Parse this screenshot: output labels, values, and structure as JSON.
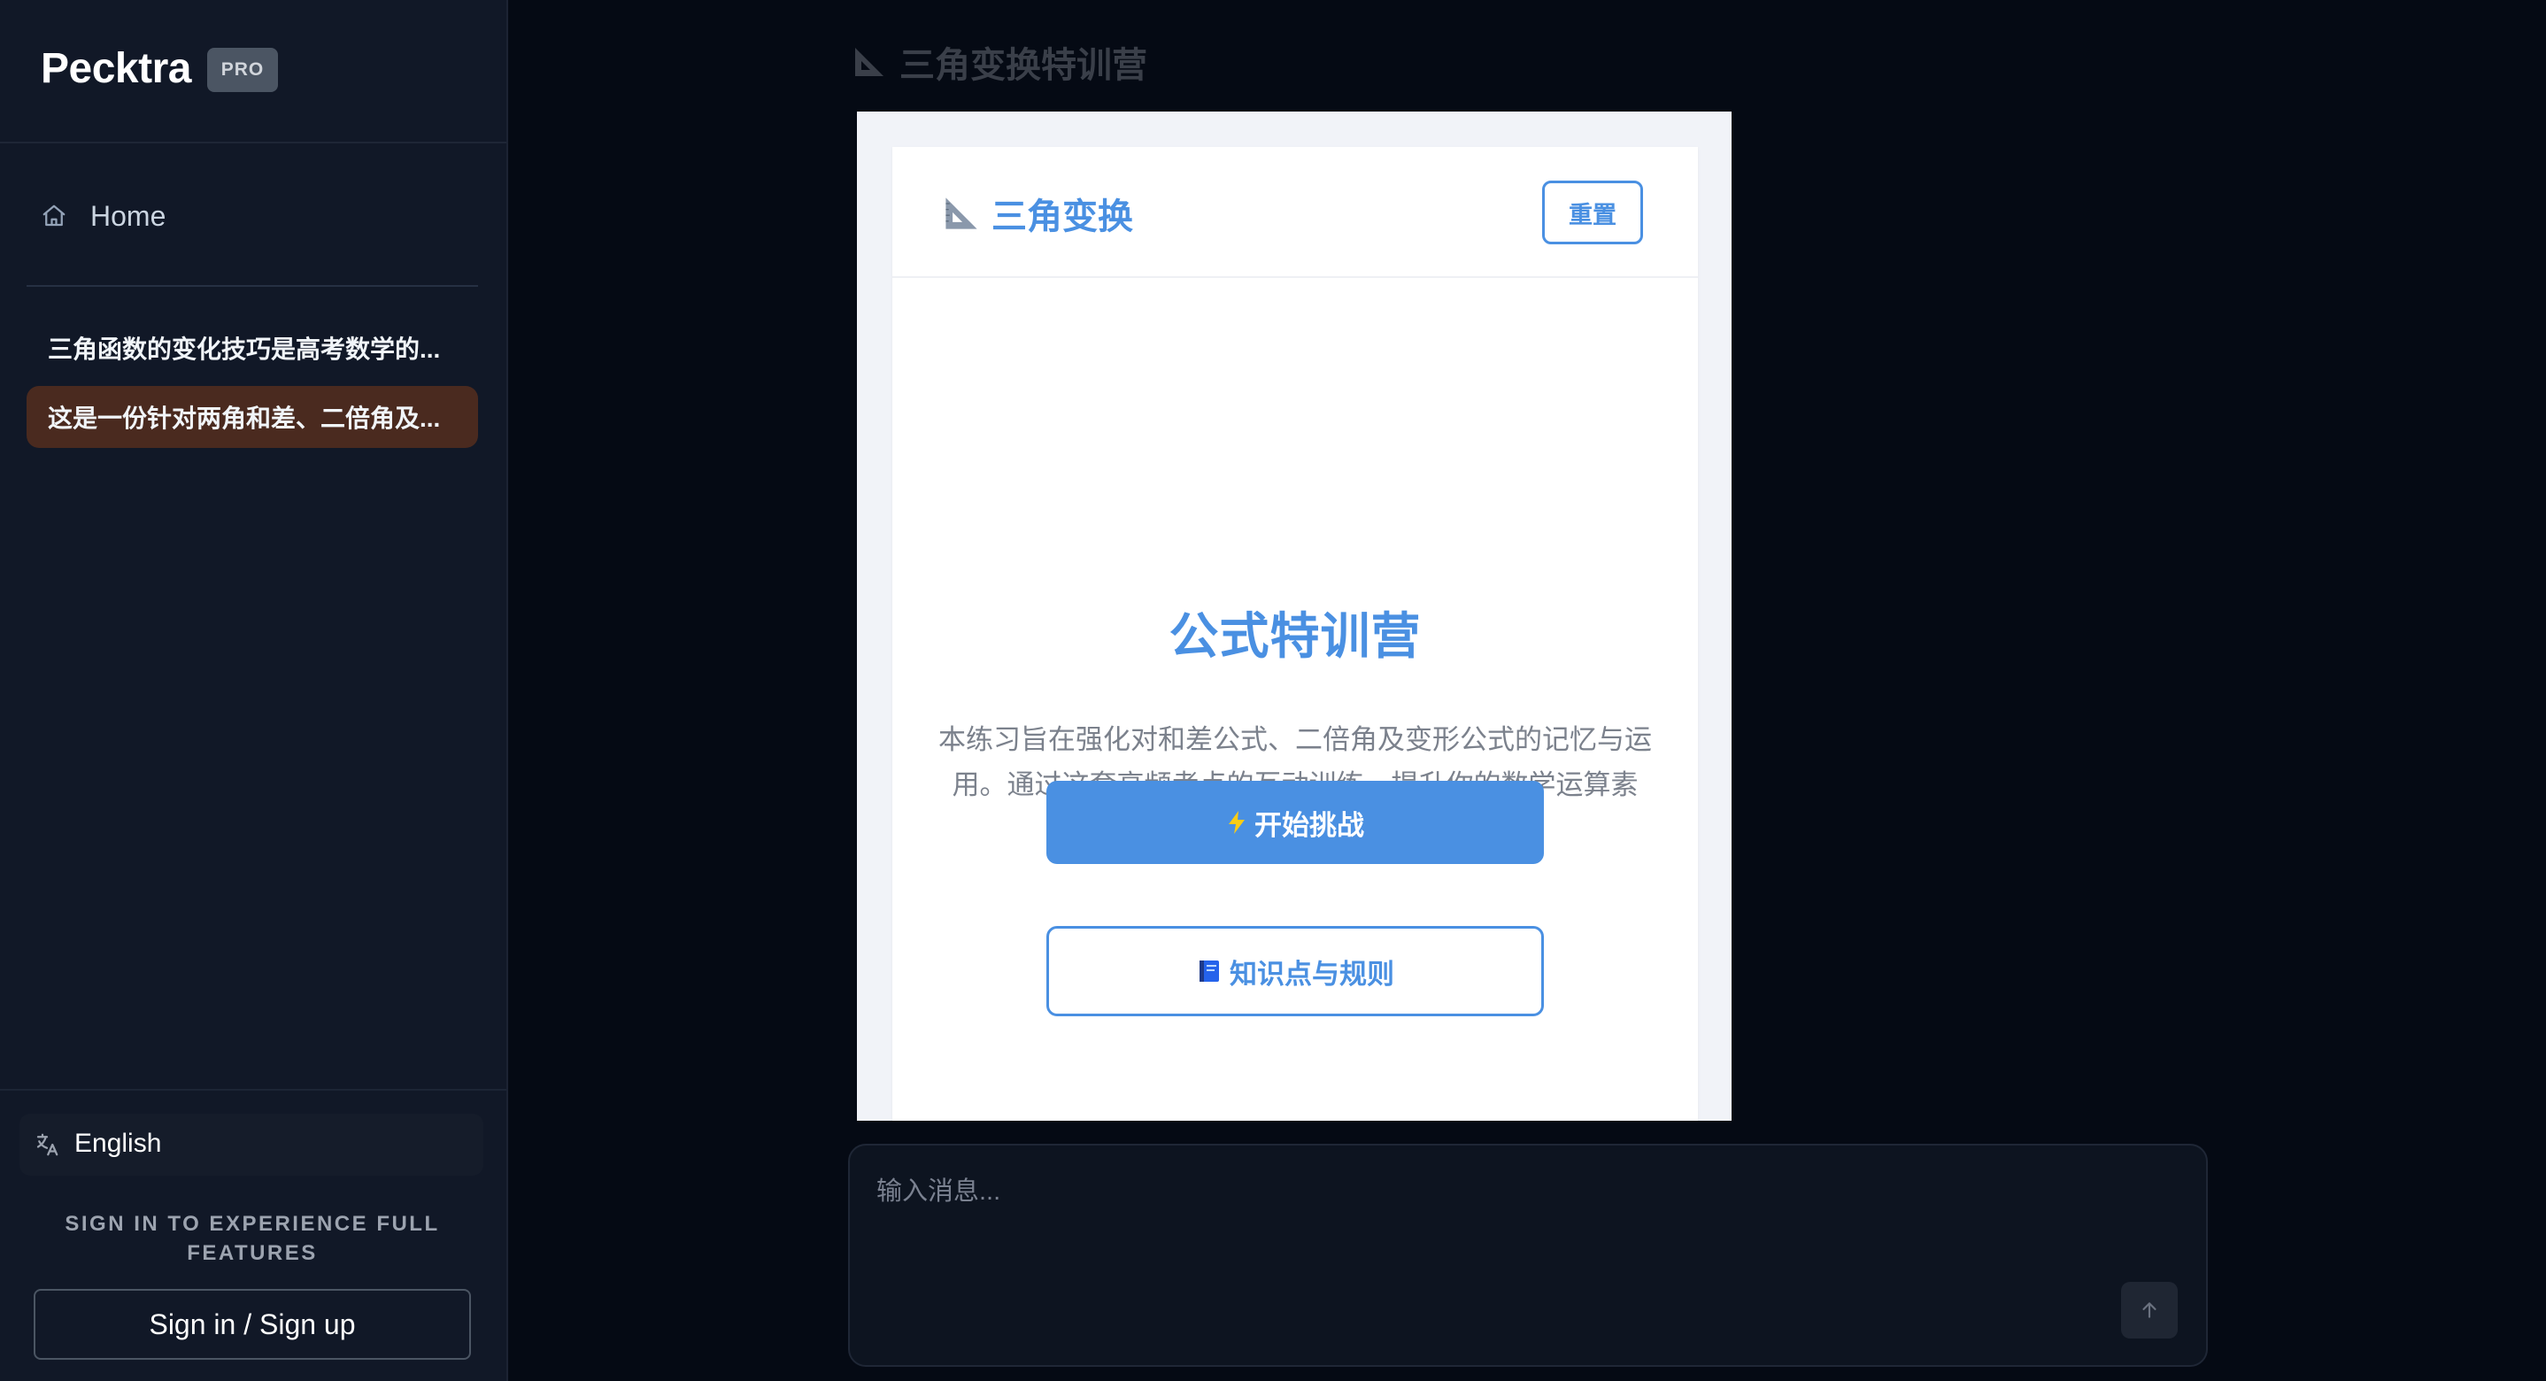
{
  "sidebar": {
    "brand": {
      "name": "Pecktra",
      "badge": "PRO"
    },
    "nav": {
      "home_label": "Home"
    },
    "history": [
      {
        "title": "三角函数的变化技巧是高考数学的..."
      },
      {
        "title": "这是一份针对两角和差、二倍角及...",
        "active": true
      }
    ],
    "language": {
      "label": "English"
    },
    "signin_hint": "SIGN IN TO EXPERIENCE FULL FEATURES",
    "signin_button": "Sign in / Sign up"
  },
  "main": {
    "title": "三角变换特训营",
    "title_icon": "triangle-ruler-icon"
  },
  "preview": {
    "header": {
      "title": "三角变换",
      "reset_label": "重置"
    },
    "hero": {
      "title": "公式特训营",
      "description": "本练习旨在强化对和差公式、二倍角及变形公式的记忆与运用。通过这套高频考点的互动训练，提升你的数学运算素养。"
    },
    "start_button": {
      "icon": "lightning-icon",
      "label": "开始挑战"
    },
    "rules_button": {
      "icon": "book-icon",
      "label": "知识点与规则"
    }
  },
  "chat": {
    "placeholder": "输入消息...",
    "send_icon": "arrow-up-icon"
  },
  "colors": {
    "accent": "#4a90e2",
    "sidebar_bg": "#111827",
    "main_bg": "#050a14",
    "active_history_bg": "#4a2a1f"
  }
}
